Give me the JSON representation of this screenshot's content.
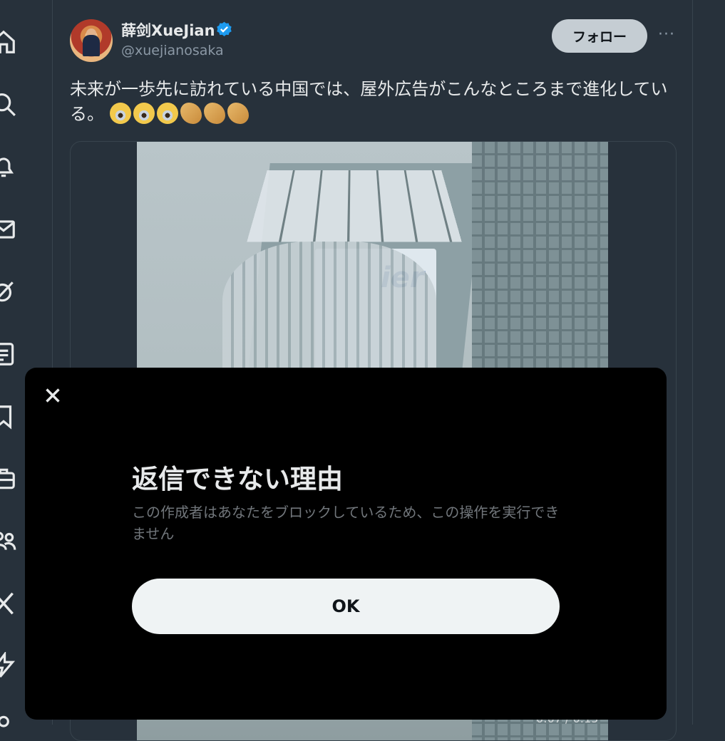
{
  "sidebar": {
    "items": [
      {
        "icon": "home-icon"
      },
      {
        "icon": "search-icon"
      },
      {
        "icon": "bell-icon"
      },
      {
        "icon": "mail-icon"
      },
      {
        "icon": "grok-icon"
      },
      {
        "icon": "list-icon"
      },
      {
        "icon": "bookmark-icon"
      },
      {
        "icon": "briefcase-icon"
      },
      {
        "icon": "communities-icon"
      },
      {
        "icon": "x-logo-icon"
      },
      {
        "icon": "lightning-icon"
      },
      {
        "icon": "profile-icon"
      }
    ]
  },
  "tweet": {
    "display_name": "薛剑XueJian",
    "handle": "@xuejianosaka",
    "follow_label": "フォロー",
    "more_label": "···",
    "text": "未来が一歩先に訪れている中国では、屋外広告がこんなところまで進化している。",
    "emojis": [
      "scream",
      "scream",
      "scream",
      "clap",
      "clap",
      "clap"
    ],
    "verified_color": "#1d9bf0"
  },
  "media": {
    "billboard_text": "ier",
    "controls_text": "0:07 / 0:15"
  },
  "modal": {
    "close_label": "×",
    "title": "返信できない理由",
    "body": "この作成者はあなたをブロックしているため、この操作を実行できません",
    "ok_label": "OK"
  },
  "colors": {
    "background": "#27313b",
    "modal": "#000000",
    "ok_button": "#eff3f4",
    "follow_button": "#c5cdd3"
  }
}
